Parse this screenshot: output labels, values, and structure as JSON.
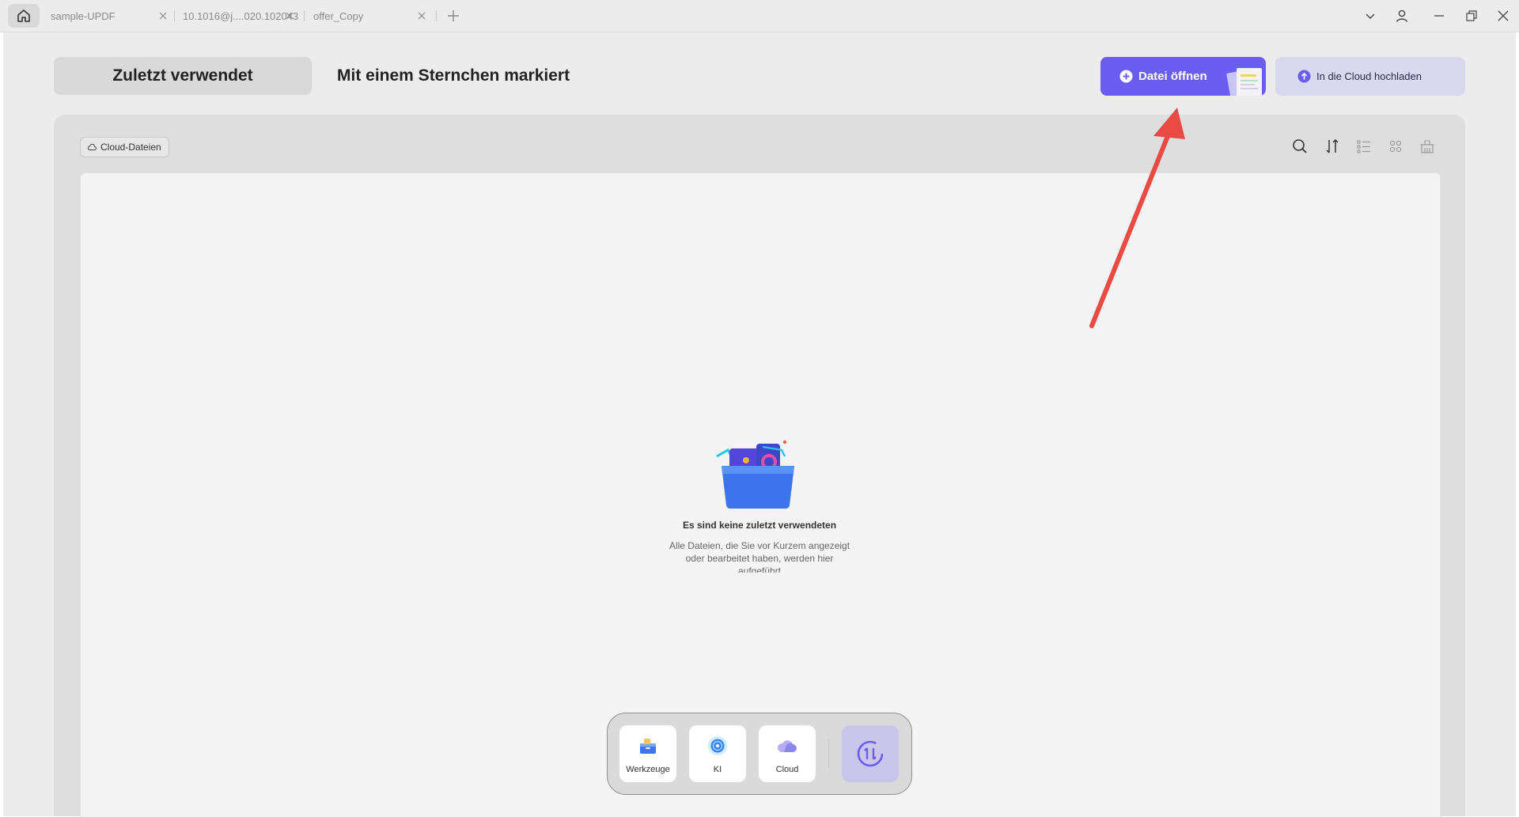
{
  "tabs": [
    {
      "title": "sample-UPDF"
    },
    {
      "title": "10.1016@j....020.102043"
    },
    {
      "title": "offer_Copy"
    }
  ],
  "header": {
    "recent_tab": "Zuletzt verwendet",
    "starred_tab": "Mit einem Sternchen markiert",
    "open_button": "Datei öffnen",
    "upload_button": "In die Cloud hochladen"
  },
  "toolbar": {
    "cloud_chip": "Cloud-Dateien"
  },
  "empty_state": {
    "title": "Es sind keine zuletzt verwendeten",
    "description": "Alle Dateien, die Sie vor Kurzem angezeigt oder bearbeitet haben, werden hier aufgeführt"
  },
  "dock": {
    "tools": "Werkzeuge",
    "ai": "KI",
    "cloud": "Cloud"
  },
  "colors": {
    "accent": "#6a5ef0",
    "annotation_arrow": "#ea4a44"
  }
}
